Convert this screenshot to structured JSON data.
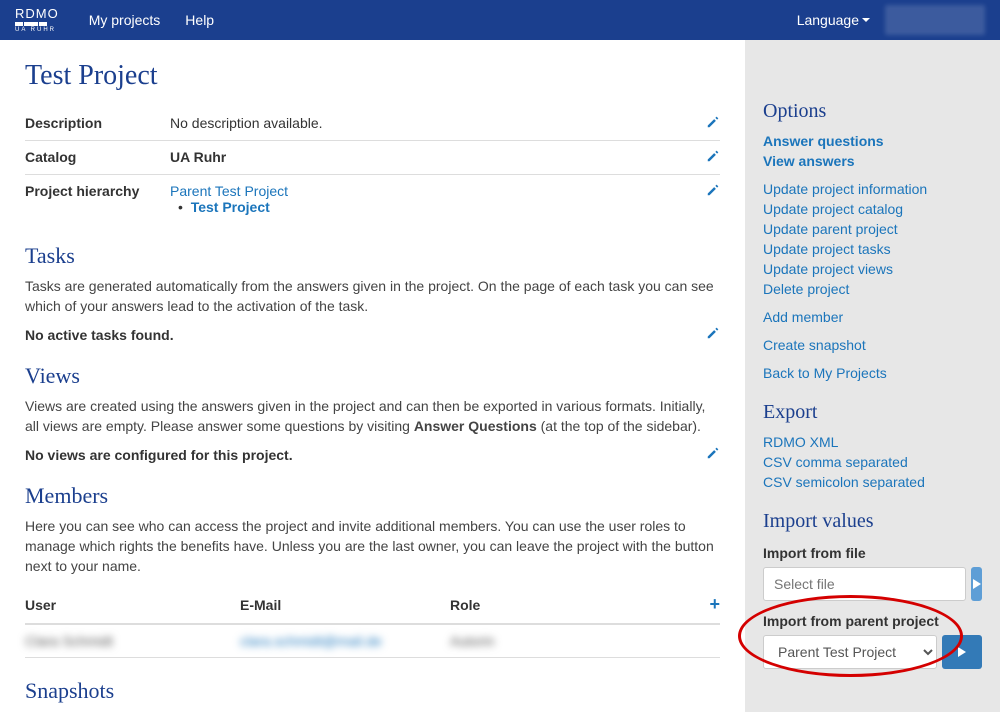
{
  "nav": {
    "brand_top": "RDMO",
    "brand_sub": "UA RUHR",
    "my_projects": "My projects",
    "help": "Help",
    "language": "Language"
  },
  "page": {
    "title": "Test Project",
    "description_label": "Description",
    "description_value": "No description available.",
    "catalog_label": "Catalog",
    "catalog_value": "UA Ruhr",
    "hierarchy_label": "Project hierarchy",
    "hierarchy_parent": "Parent Test Project",
    "hierarchy_current": "Test Project"
  },
  "tasks": {
    "heading": "Tasks",
    "desc": "Tasks are generated automatically from the answers given in the project. On the page of each task you can see which of your answers lead to the activation of the task.",
    "empty": "No active tasks found."
  },
  "views": {
    "heading": "Views",
    "desc_p1": "Views are created using the answers given in the project and can then be exported in various formats. Initially, all views are empty. Please answer some questions by visiting ",
    "desc_bold": "Answer Questions",
    "desc_p2": " (at the top of the sidebar).",
    "empty": "No views are configured for this project."
  },
  "members": {
    "heading": "Members",
    "desc": "Here you can see who can access the project and invite additional members. You can use the user roles to manage which rights the benefits have. Unless you are the last owner, you can leave the project with the button next to your name.",
    "col_user": "User",
    "col_email": "E-Mail",
    "col_role": "Role",
    "row_user": "Clara Schmidt",
    "row_email": "clara.schmidt@mail.de",
    "row_role": "Autorin"
  },
  "snapshots": {
    "heading": "Snapshots"
  },
  "sidebar": {
    "options_h": "Options",
    "answer_q": "Answer questions",
    "view_a": "View answers",
    "upd_info": "Update project information",
    "upd_catalog": "Update project catalog",
    "upd_parent": "Update parent project",
    "upd_tasks": "Update project tasks",
    "upd_views": "Update project views",
    "delete": "Delete project",
    "add_member": "Add member",
    "create_snap": "Create snapshot",
    "back": "Back to My Projects",
    "export_h": "Export",
    "exp_xml": "RDMO XML",
    "exp_csv_c": "CSV comma separated",
    "exp_csv_s": "CSV semicolon separated",
    "import_h": "Import values",
    "import_file_label": "Import from file",
    "import_file_placeholder": "Select file",
    "import_parent_label": "Import from parent project",
    "import_parent_option": "Parent Test Project"
  }
}
